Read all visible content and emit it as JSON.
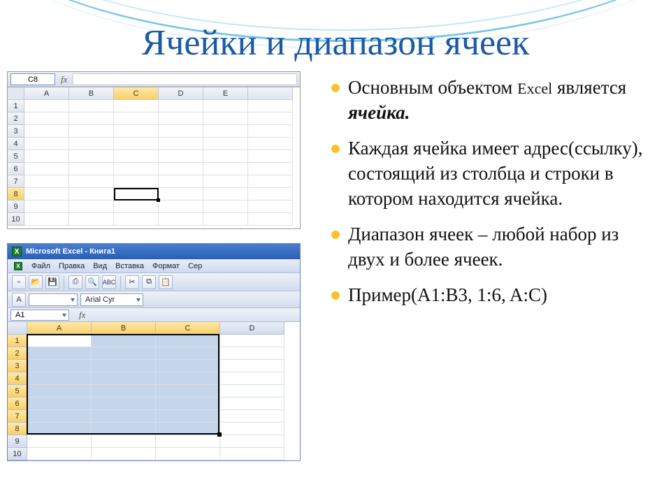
{
  "title": "Ячейки и диапазон ячеек",
  "bullets": {
    "b1_pre": "Основным объектом ",
    "b1_excel": "Excel",
    "b1_post": " является ",
    "b1_emph": "ячейка.",
    "b2": "Каждая ячейка имеет адрес(ссылку), состоящий из столбца и строки в котором находится ячейка.",
    "b3": "Диапазон ячеек – любой набор из двух и более ячеек.",
    "b4": "Пример(A1:B3, 1:6, A:C)"
  },
  "excel1": {
    "namebox": "C8",
    "fx": "fx",
    "columns": [
      "A",
      "B",
      "C",
      "D",
      "E",
      ""
    ],
    "rows": [
      "1",
      "2",
      "3",
      "4",
      "5",
      "6",
      "7",
      "8",
      "9",
      "10"
    ],
    "active_col": "C",
    "active_row": "8"
  },
  "excel2": {
    "title": "Microsoft Excel - Книга1",
    "xicon": "X",
    "menu": [
      "Файл",
      "Правка",
      "Вид",
      "Вставка",
      "Формат",
      "Сер"
    ],
    "font": "Arial Cyr",
    "namebox": "A1",
    "fx": "fx",
    "columns": [
      "A",
      "B",
      "C",
      "D"
    ],
    "rows": [
      "1",
      "2",
      "3",
      "4",
      "5",
      "6",
      "7",
      "8",
      "9",
      "10"
    ],
    "selected_cols": [
      "A",
      "B",
      "C"
    ],
    "selected_rows": [
      "1",
      "2",
      "3",
      "4",
      "5",
      "6",
      "7",
      "8"
    ]
  }
}
